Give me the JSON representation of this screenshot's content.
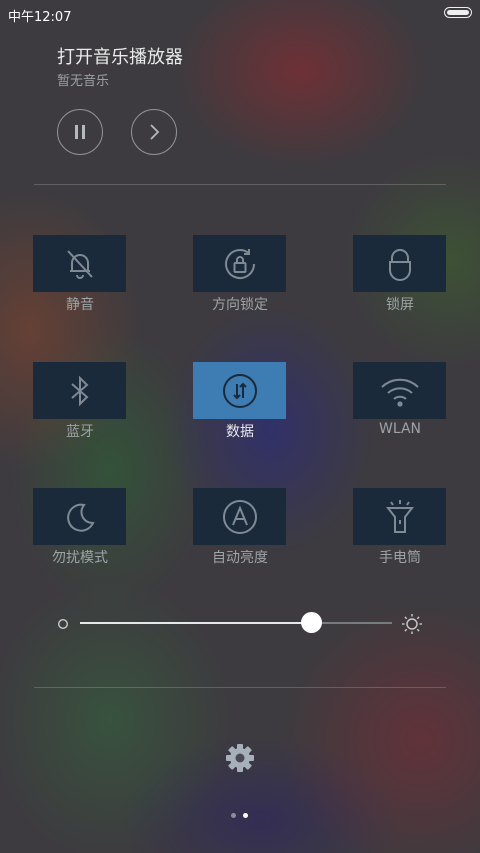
{
  "status": {
    "time": "中午12:07"
  },
  "music": {
    "title": "打开音乐播放器",
    "subtitle": "暂无音乐",
    "pause_icon": "pause-icon",
    "next_icon": "chevron-right-icon"
  },
  "toggles": [
    {
      "label": "静音",
      "icon": "bell-off-icon",
      "active": false
    },
    {
      "label": "方向锁定",
      "icon": "rotation-lock-icon",
      "active": false
    },
    {
      "label": "锁屏",
      "icon": "lock-icon",
      "active": false
    },
    {
      "label": "蓝牙",
      "icon": "bluetooth-icon",
      "active": false
    },
    {
      "label": "数据",
      "icon": "mobile-data-icon",
      "active": true
    },
    {
      "label": "WLAN",
      "icon": "wifi-icon",
      "active": false
    },
    {
      "label": "勿扰模式",
      "icon": "moon-icon",
      "active": false
    },
    {
      "label": "自动亮度",
      "icon": "auto-brightness-icon",
      "active": false
    },
    {
      "label": "手电筒",
      "icon": "flashlight-icon",
      "active": false
    }
  ],
  "brightness": {
    "level": 0.74,
    "min_icon": "brightness-low-icon",
    "max_icon": "brightness-high-icon"
  },
  "settings_icon": "gear-icon",
  "pager": {
    "pages": 2,
    "current": 2
  },
  "colors": {
    "active_tile": "#3d7db3",
    "tile": "#1b2a3a"
  }
}
